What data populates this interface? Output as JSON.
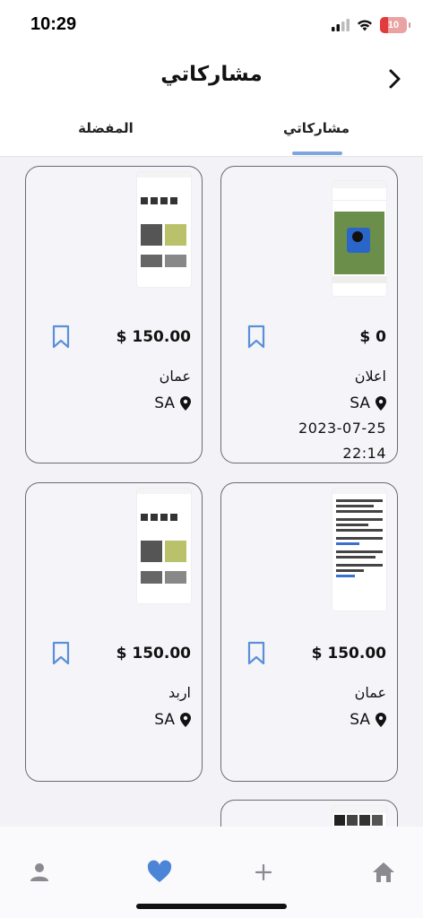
{
  "status_bar": {
    "time": "10:29",
    "battery": "10"
  },
  "header": {
    "title": "مشاركاتي",
    "back_icon": "chevron-right-icon"
  },
  "tabs": [
    {
      "label": "المفضلة",
      "active": false
    },
    {
      "label": "مشاركاتي",
      "active": true
    }
  ],
  "colors": {
    "accent": "#7fa6df",
    "nav_active": "#4c84d8",
    "bookmark": "#5a90d8"
  },
  "listings": [
    {
      "price": "$ 0",
      "city": "اعلان",
      "country": "SA",
      "date": "2023-07-25",
      "time": "22:14"
    },
    {
      "price": "$ 150.00",
      "city": "عمان",
      "country": "SA"
    },
    {
      "price": "$ 150.00",
      "city": "عمان",
      "country": "SA"
    },
    {
      "price": "$ 150.00",
      "city": "اربد",
      "country": "SA"
    }
  ],
  "bottom_nav": [
    {
      "icon": "home-icon",
      "active": false
    },
    {
      "icon": "plus-icon",
      "active": false
    },
    {
      "icon": "heart-icon",
      "active": true
    },
    {
      "icon": "person-icon",
      "active": false
    }
  ]
}
